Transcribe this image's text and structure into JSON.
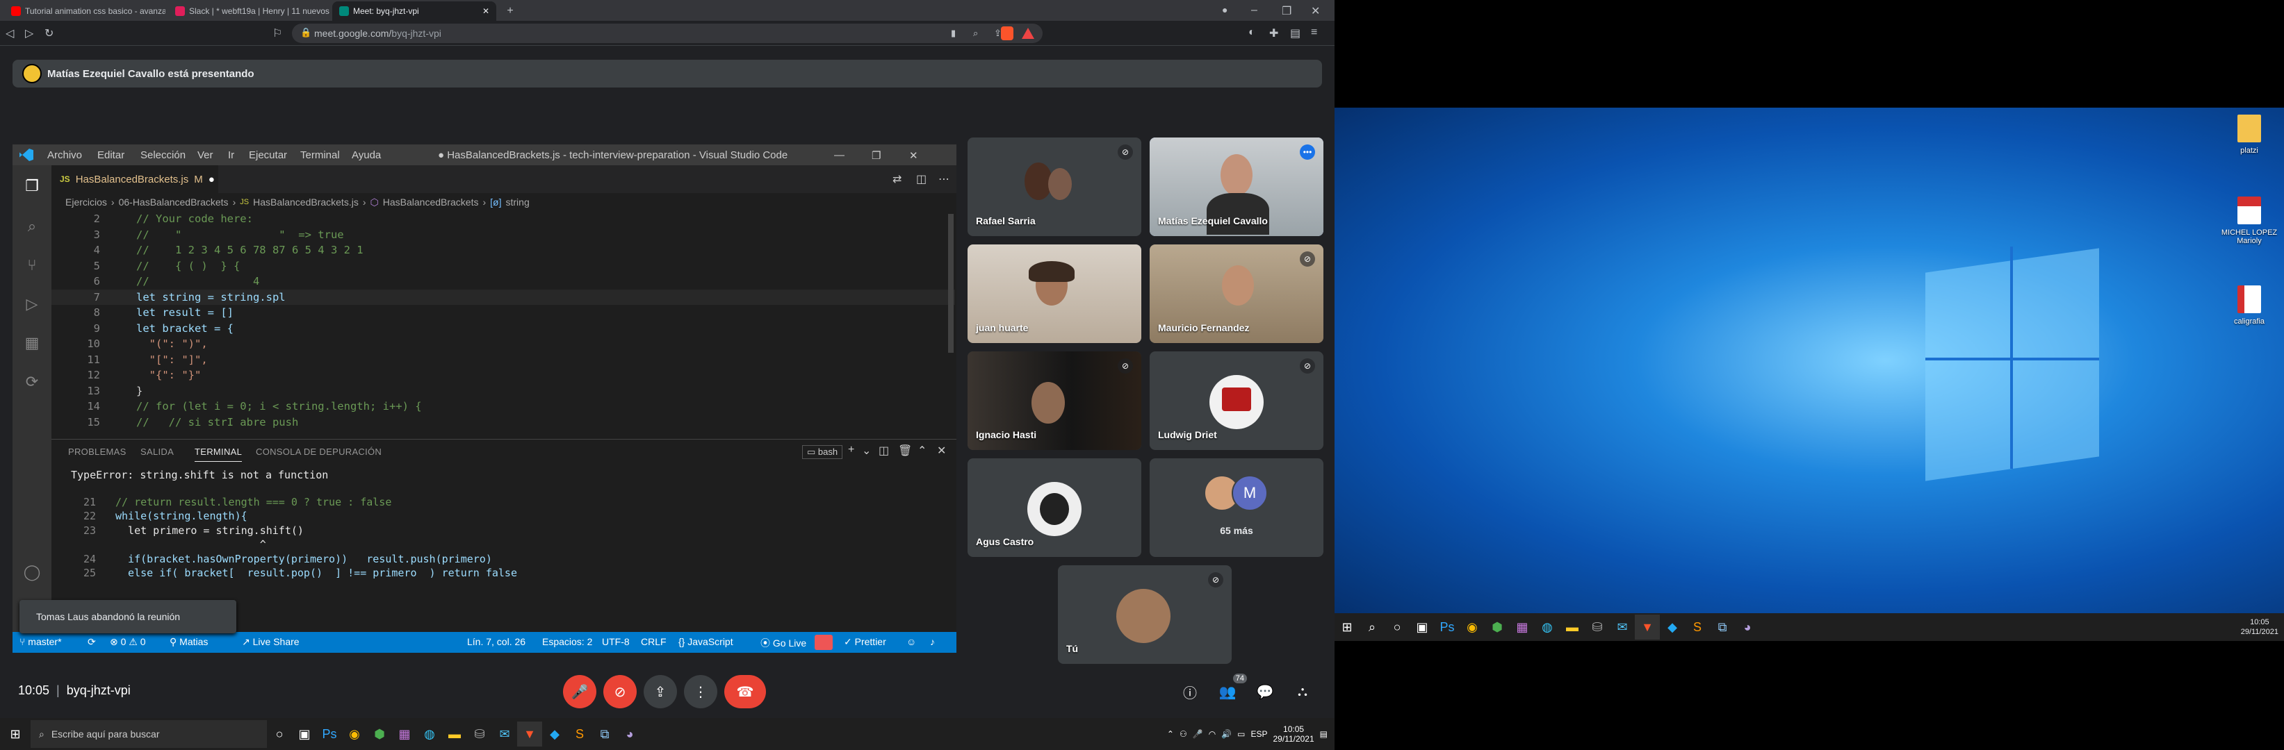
{
  "browser": {
    "tabs": [
      {
        "label": "Tutorial animation css basico - avanzado",
        "color": "#ff0000"
      },
      {
        "label": "Slack | * webft19a | Henry | 11 nuevos",
        "color": "#e01e5a"
      },
      {
        "label": "Meet: byq-jhzt-vpi",
        "color": "#00897b"
      }
    ],
    "url_host": "meet.google.com/",
    "url_path": "byq-jhzt-vpi",
    "new_tab": "+"
  },
  "meet": {
    "presenting_banner": "Matías Ezequiel Cavallo está presentando",
    "time": "10:05",
    "code": "byq-jhzt-vpi",
    "people_count": "74",
    "toast": "Tomas Laus abandonó la reunión",
    "participants": [
      {
        "name": "Rafael Sarria",
        "muted": true
      },
      {
        "name": "Matías Ezequiel Cavallo",
        "muted": false,
        "speaking": true
      },
      {
        "name": "juan huarte",
        "muted": false
      },
      {
        "name": "Mauricio Fernandez",
        "muted": true
      },
      {
        "name": "Ignacio Hasti",
        "muted": true
      },
      {
        "name": "Ludwig Driet",
        "muted": true
      },
      {
        "name": "Agus Castro",
        "muted": false
      },
      {
        "name": "65 más",
        "muted": false,
        "avatar_letter": "M"
      },
      {
        "name": "Tú",
        "muted": true
      }
    ]
  },
  "vscode": {
    "title": "● HasBalancedBrackets.js - tech-interview-preparation - Visual Studio Code",
    "menu": [
      "Archivo",
      "Editar",
      "Selección",
      "Ver",
      "Ir",
      "Ejecutar",
      "Terminal",
      "Ayuda"
    ],
    "tab": {
      "label": "HasBalancedBrackets.js",
      "badge": "M",
      "dirty": "●"
    },
    "breadcrumb": [
      "Ejercicios",
      "06-HasBalancedBrackets",
      "HasBalancedBrackets.js",
      "HasBalancedBrackets",
      "string"
    ],
    "code": [
      {
        "n": "2",
        "t": "// Your code here:"
      },
      {
        "n": "3",
        "t": "//    \"               \"  => true"
      },
      {
        "n": "4",
        "t": "//    1 2 3 4 5 6 78 87 6 5 4 3 2 1"
      },
      {
        "n": "5",
        "t": "//    { ( )  } {"
      },
      {
        "n": "6",
        "t": "//                4"
      },
      {
        "n": "7",
        "t": "let string = string.spl"
      },
      {
        "n": "8",
        "t": "let result = []"
      },
      {
        "n": "9",
        "t": "let bracket = {"
      },
      {
        "n": "10",
        "t": "  \"(\": \")\","
      },
      {
        "n": "11",
        "t": "  \"[\": \"]\","
      },
      {
        "n": "12",
        "t": "  \"{\": \"}\""
      },
      {
        "n": "13",
        "t": "}"
      },
      {
        "n": "14",
        "t": "// for (let i = 0; i < string.length; i++) {"
      },
      {
        "n": "15",
        "t": "//   // si strI abre push"
      }
    ],
    "panel_tabs": [
      "PROBLEMAS",
      "SALIDA",
      "TERMINAL",
      "CONSOLA DE DEPURACIÓN"
    ],
    "shell": "bash",
    "terminal": [
      {
        "n": "",
        "t": "TypeError: string.shift is not a function"
      },
      {
        "n": "21",
        "t": "// return result.length === 0 ? true : false"
      },
      {
        "n": "22",
        "t": "while(string.length){"
      },
      {
        "n": "23",
        "t": "  let primero = string.shift()"
      },
      {
        "n": "",
        "t": "                       ^"
      },
      {
        "n": "24",
        "t": "  if(bracket.hasOwnProperty(primero))   result.push(primero)"
      },
      {
        "n": "25",
        "t": "  else if( bracket[  result.pop()  ] !== primero  ) return false"
      }
    ],
    "status": {
      "branch": "master*",
      "errors": "⊗ 0 ⚠ 0",
      "user": "Matias",
      "liveshare": "Live Share",
      "pos": "Lín. 7, col. 26",
      "spaces": "Espacios: 2",
      "enc": "UTF-8",
      "eol": "CRLF",
      "lang": "JavaScript",
      "golive": "Go Live",
      "prettier": "Prettier"
    }
  },
  "taskbar_left": {
    "search": "Escribe aquí para buscar",
    "lang": "ESP",
    "time": "10:05",
    "date": "29/11/2021"
  },
  "desktop": {
    "icons": [
      "platzi",
      "MICHEL LOPEZ Marioly",
      "caligrafia"
    ],
    "time": "10:05",
    "date": "29/11/2021"
  }
}
